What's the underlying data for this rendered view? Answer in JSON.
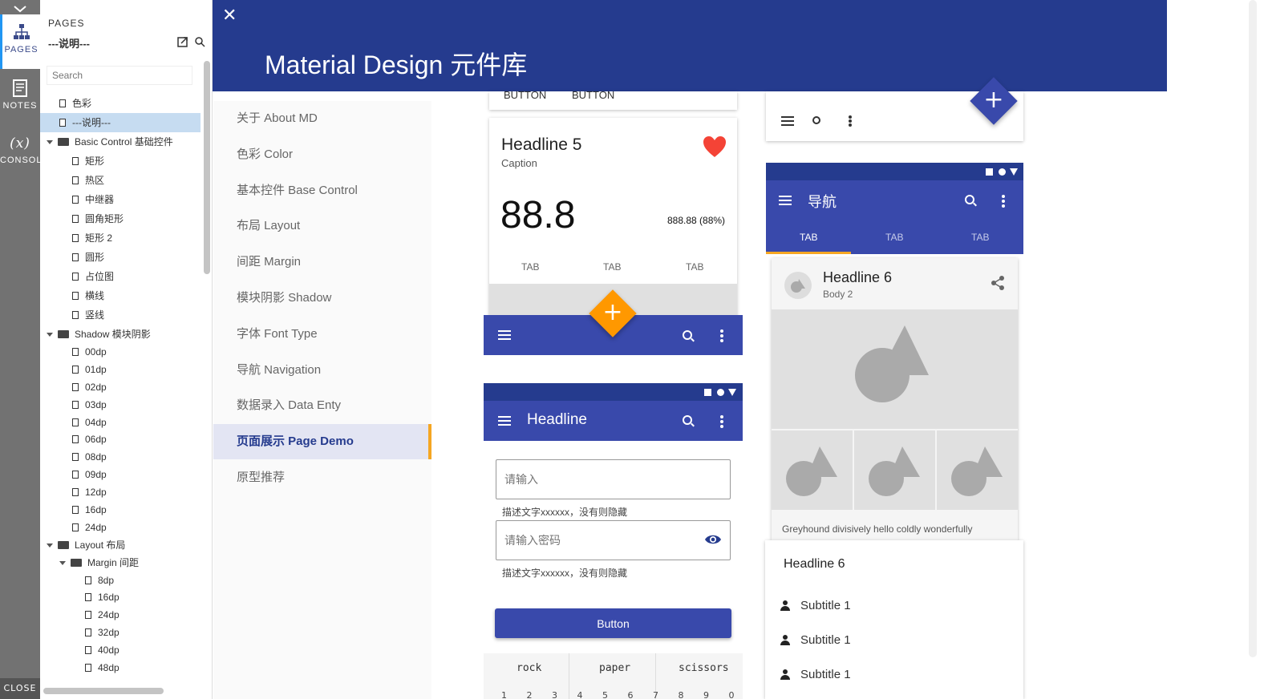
{
  "rail": {
    "pages_label": "PAGES",
    "notes_label": "NOTES",
    "console_label": "CONSOLE",
    "console_glyph": "(x)",
    "close_label": "CLOSE"
  },
  "pages_panel": {
    "header": "PAGES",
    "current_page": "---说明---",
    "search_placeholder": "Search",
    "tree": [
      {
        "label": "色彩",
        "type": "page",
        "level": 0
      },
      {
        "label": "---说明---",
        "type": "page",
        "level": 0,
        "selected": true
      },
      {
        "label": "Basic Control 基础控件",
        "type": "folder",
        "level": 0
      },
      {
        "label": "矩形",
        "type": "page",
        "level": 1
      },
      {
        "label": "热区",
        "type": "page",
        "level": 1
      },
      {
        "label": "中继器",
        "type": "page",
        "level": 1
      },
      {
        "label": "圆角矩形",
        "type": "page",
        "level": 1
      },
      {
        "label": "矩形 2",
        "type": "page",
        "level": 1
      },
      {
        "label": "圆形",
        "type": "page",
        "level": 1
      },
      {
        "label": "占位图",
        "type": "page",
        "level": 1
      },
      {
        "label": "横线",
        "type": "page",
        "level": 1
      },
      {
        "label": "竖线",
        "type": "page",
        "level": 1
      },
      {
        "label": "Shadow 模块阴影",
        "type": "folder",
        "level": 0
      },
      {
        "label": "00dp",
        "type": "page",
        "level": 1
      },
      {
        "label": "01dp",
        "type": "page",
        "level": 1
      },
      {
        "label": "02dp",
        "type": "page",
        "level": 1
      },
      {
        "label": "03dp",
        "type": "page",
        "level": 1
      },
      {
        "label": "04dp",
        "type": "page",
        "level": 1
      },
      {
        "label": "06dp",
        "type": "page",
        "level": 1
      },
      {
        "label": "08dp",
        "type": "page",
        "level": 1
      },
      {
        "label": "09dp",
        "type": "page",
        "level": 1
      },
      {
        "label": "12dp",
        "type": "page",
        "level": 1
      },
      {
        "label": "16dp",
        "type": "page",
        "level": 1
      },
      {
        "label": "24dp",
        "type": "page",
        "level": 1
      },
      {
        "label": "Layout 布局",
        "type": "folder",
        "level": 0
      },
      {
        "label": "Margin 间距",
        "type": "folder",
        "level": 1
      },
      {
        "label": "8dp",
        "type": "page",
        "level": 2
      },
      {
        "label": "16dp",
        "type": "page",
        "level": 2
      },
      {
        "label": "24dp",
        "type": "page",
        "level": 2
      },
      {
        "label": "32dp",
        "type": "page",
        "level": 2
      },
      {
        "label": "40dp",
        "type": "page",
        "level": 2
      },
      {
        "label": "48dp",
        "type": "page",
        "level": 2
      }
    ]
  },
  "header": {
    "close_glyph": "✕",
    "title": "Material Design 元件库"
  },
  "menu": [
    {
      "label": "关于 About MD"
    },
    {
      "label": "色彩 Color"
    },
    {
      "label": "基本控件 Base Control"
    },
    {
      "label": "布局 Layout"
    },
    {
      "label": "间距 Margin"
    },
    {
      "label": "模块阴影 Shadow"
    },
    {
      "label": "字体 Font Type"
    },
    {
      "label": "导航 Navigation"
    },
    {
      "label": "数据录入 Data Enty"
    },
    {
      "label": "页面展示 Page Demo",
      "active": true
    },
    {
      "label": "原型推荐"
    }
  ],
  "card1": {
    "button1": "BUTTON",
    "button2": "BUTTON",
    "headline": "Headline 5",
    "caption": "Caption",
    "big_value": "88.8",
    "small_value": "888.88 (88%)",
    "tabs": [
      "TAB",
      "TAB",
      "TAB"
    ],
    "fab_glyph": "+"
  },
  "card2": {
    "title": "Headline",
    "input_placeholder": "请输入",
    "helper1": "描述文字xxxxxx，没有则隐藏",
    "password_placeholder": "请输入密码",
    "helper2": "描述文字xxxxxx，没有则隐藏",
    "button": "Button",
    "table_headers": [
      "rock",
      "paper",
      "scissors"
    ],
    "table_row_partial": [
      "1",
      "2",
      "3",
      "4",
      "5",
      "6",
      "7",
      "8",
      "9",
      "0"
    ]
  },
  "card3": {
    "fab_glyph": "+",
    "title": "导航",
    "tabs": [
      "TAB",
      "TAB",
      "TAB"
    ],
    "headline": "Headline 6",
    "body": "Body 2",
    "text": "Greyhound divisively hello coldly wonderfully"
  },
  "card4": {
    "headline": "Headline 6",
    "items": [
      "Subtitle 1",
      "Subtitle 1",
      "Subtitle 1"
    ]
  },
  "colors": {
    "primary": "#3949ab",
    "primary_dark": "#253b8e",
    "accent": "#f5a623",
    "fab_orange": "#ff9800",
    "heart": "#f44336"
  }
}
